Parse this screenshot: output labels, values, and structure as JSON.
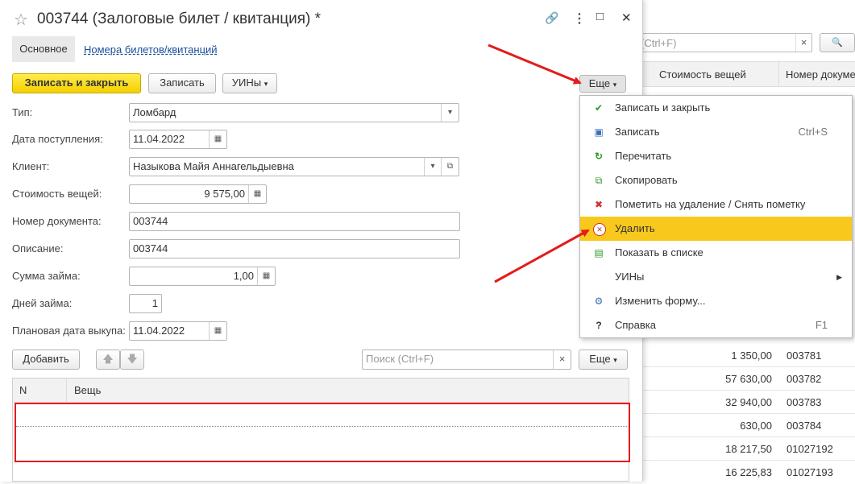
{
  "bg": {
    "search_placeholder": "(Ctrl+F)",
    "clear": "×",
    "search_btn": "🔍",
    "col_cost": "Стоимость вещей",
    "col_doc": "Номер докуме",
    "rows": [
      {
        "cost": "1 350,00",
        "doc": "003781"
      },
      {
        "cost": "57 630,00",
        "doc": "003782"
      },
      {
        "cost": "32 940,00",
        "doc": "003783"
      },
      {
        "cost": "630,00",
        "doc": "003784"
      },
      {
        "cost": "18 217,50",
        "doc": "01027192"
      },
      {
        "cost": "16 225,83",
        "doc": "01027193"
      }
    ]
  },
  "window": {
    "star": "☆",
    "title": "003744 (Залоговые билет / квитанция) *",
    "link_icon": "🔗",
    "more_icon": "⋮",
    "max_icon": "□",
    "close_icon": "✕",
    "tab_main": "Основное",
    "tab_numbers": "Номера билетов/квитанций"
  },
  "toolbar": {
    "save_close": "Записать и закрыть",
    "save": "Записать",
    "uins": "УИНы",
    "more": "Еще"
  },
  "form": {
    "type_label": "Тип:",
    "type_value": "Ломбард",
    "date_label": "Дата поступления:",
    "date_value": "11.04.2022",
    "client_label": "Клиент:",
    "client_value": "Назыкова Майя Аннагельдыевна",
    "cost_label": "Стоимость вещей:",
    "cost_value": "9 575,00",
    "docnum_label": "Номер документа:",
    "docnum_value": "003744",
    "desc_label": "Описание:",
    "desc_value": "003744",
    "loan_label": "Сумма займа:",
    "loan_value": "1,00",
    "days_label": "Дней займа:",
    "days_value": "1",
    "buyback_label": "Плановая дата выкупа:",
    "buyback_value": "11.04.2022"
  },
  "table": {
    "add": "Добавить",
    "search_placeholder": "Поиск (Ctrl+F)",
    "clear": "×",
    "more": "Еще",
    "col_n": "N",
    "col_item": "Вещь"
  },
  "menu": {
    "items": [
      {
        "label": "Записать и закрыть",
        "shortcut": "",
        "icon": "✔"
      },
      {
        "label": "Записать",
        "shortcut": "Ctrl+S",
        "icon": "▣"
      },
      {
        "label": "Перечитать",
        "shortcut": "",
        "icon": "↻"
      },
      {
        "label": "Скопировать",
        "shortcut": "",
        "icon": "⧉"
      },
      {
        "label": "Пометить на удаление / Снять пометку",
        "shortcut": "",
        "icon": "✖"
      },
      {
        "label": "Удалить",
        "shortcut": "",
        "icon": "✕"
      },
      {
        "label": "Показать в списке",
        "shortcut": "",
        "icon": "▤"
      },
      {
        "label": "УИНы",
        "shortcut": "",
        "icon": ""
      },
      {
        "label": "Изменить форму...",
        "shortcut": "",
        "icon": "⚙"
      },
      {
        "label": "Справка",
        "shortcut": "F1",
        "icon": "?"
      }
    ],
    "submenu_arrow": "▶"
  },
  "colors": {
    "accent_yellow": "#f8c81d",
    "annotation_red": "#e41b1b",
    "link_blue": "#1a4f9c"
  }
}
